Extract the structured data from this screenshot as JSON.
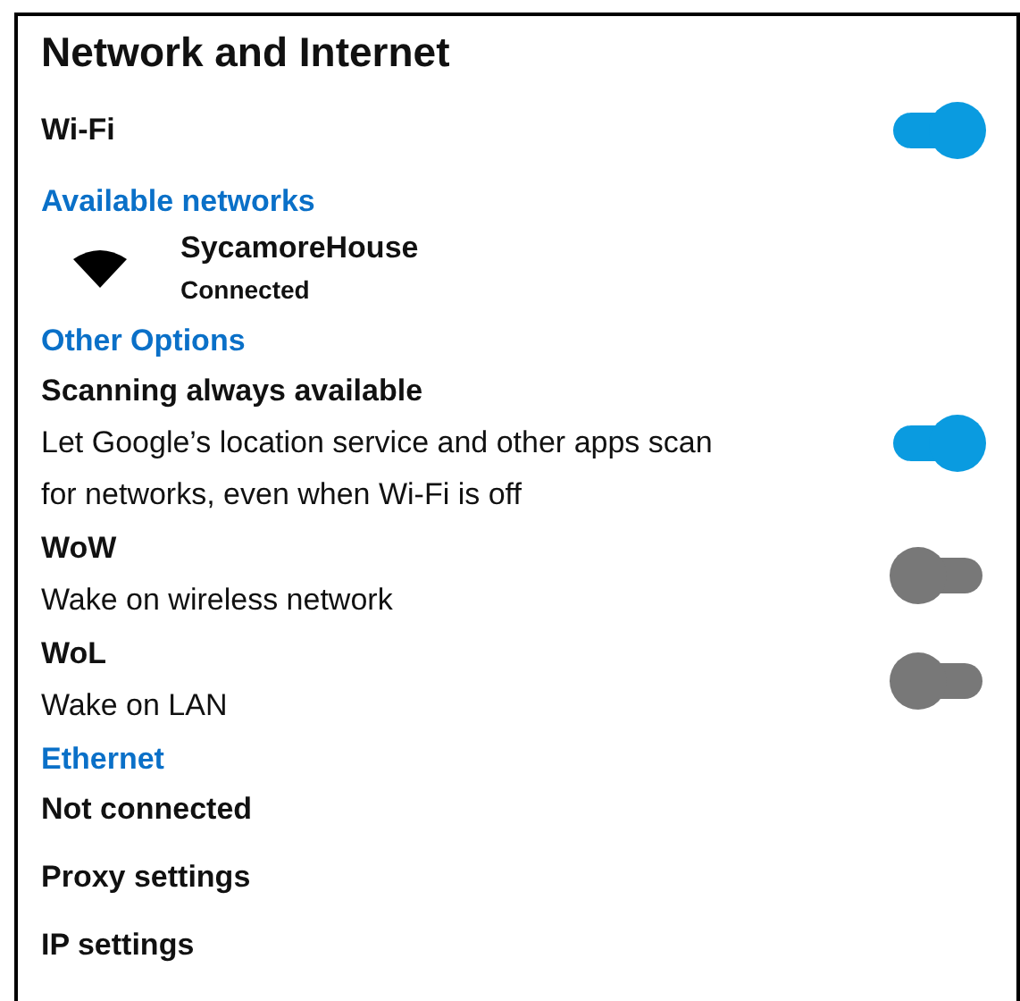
{
  "page": {
    "title": "Network and Internet"
  },
  "items": [
    {
      "kind": "switch",
      "label": "Wi-Fi",
      "on": true
    },
    {
      "kind": "heading",
      "label": "Available networks"
    },
    {
      "kind": "network",
      "name": "SycamoreHouse",
      "status": "Connected"
    },
    {
      "kind": "heading",
      "label": "Other Options"
    },
    {
      "kind": "switch",
      "label": "Scanning always available",
      "description": "Let Google’s location service and other apps scan for networks, even when Wi-Fi is off",
      "on": true
    },
    {
      "kind": "switch",
      "label": "WoW",
      "description": "Wake on wireless network",
      "on": false
    },
    {
      "kind": "switch",
      "label": "WoL",
      "description": "Wake on LAN",
      "on": false
    },
    {
      "kind": "heading",
      "label": "Ethernet"
    },
    {
      "kind": "entry",
      "label": "Not connected"
    },
    {
      "kind": "entry",
      "label": "Proxy settings"
    },
    {
      "kind": "entry",
      "label": "IP settings"
    }
  ]
}
